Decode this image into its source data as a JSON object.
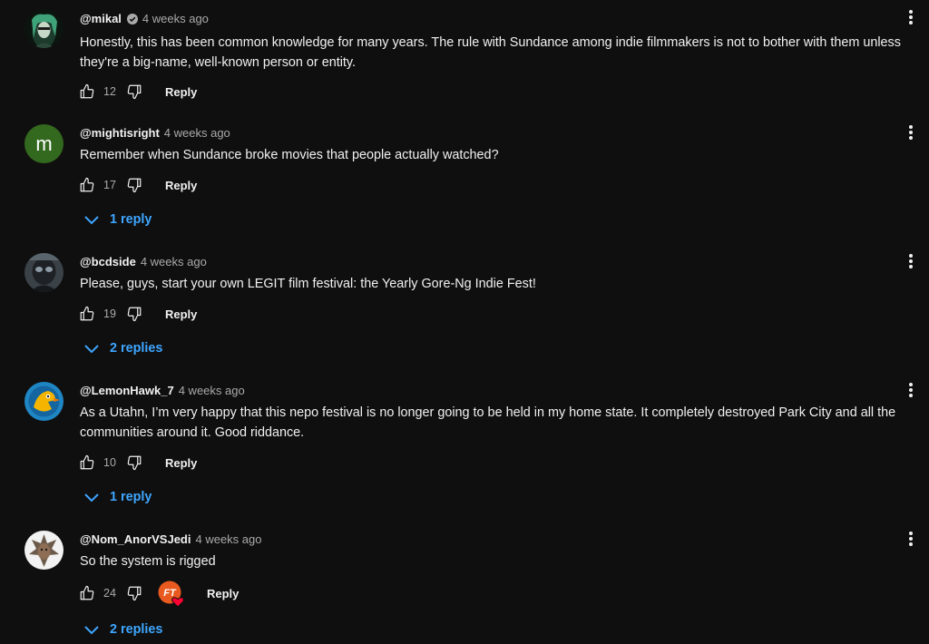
{
  "comments": [
    {
      "author": "@mikal",
      "verified": true,
      "time": "4 weeks ago",
      "text": "Honestly, this has been common knowledge for many years. The rule with Sundance among indie filmmakers is not to bother with them unless they're a big-name, well-known person or entity.",
      "likes": "12",
      "reply_label": "Reply"
    },
    {
      "author": "@mightisright",
      "avatar_letter": "m",
      "time": "4 weeks ago",
      "text": "Remember when Sundance broke movies that people actually watched?",
      "likes": "17",
      "reply_label": "Reply",
      "replies_label": "1 reply"
    },
    {
      "author": "@bcdside",
      "time": "4 weeks ago",
      "text": "Please, guys, start your own LEGIT film festival: the Yearly Gore-Ng Indie Fest!",
      "likes": "19",
      "reply_label": "Reply",
      "replies_label": "2 replies"
    },
    {
      "author": "@LemonHawk_7",
      "time": "4 weeks ago",
      "text": "As a Utahn, I’m very happy that this nepo festival is no longer going to be held in my home state. It completely destroyed Park City and all the communities around it. Good riddance.",
      "likes": "10",
      "reply_label": "Reply",
      "replies_label": "1 reply"
    },
    {
      "author": "@Nom_AnorVSJedi",
      "time": "4 weeks ago",
      "text": "So the system is rigged",
      "likes": "24",
      "reply_label": "Reply",
      "replies_label": "2 replies",
      "creator_badge_text": "FT"
    }
  ],
  "colors": {
    "background": "#0f0f0f",
    "text": "#f1f1f1",
    "secondary": "#aaaaaa",
    "link": "#3ea6ff",
    "avatar_green": "#33691e",
    "heart": "#ff0033"
  }
}
